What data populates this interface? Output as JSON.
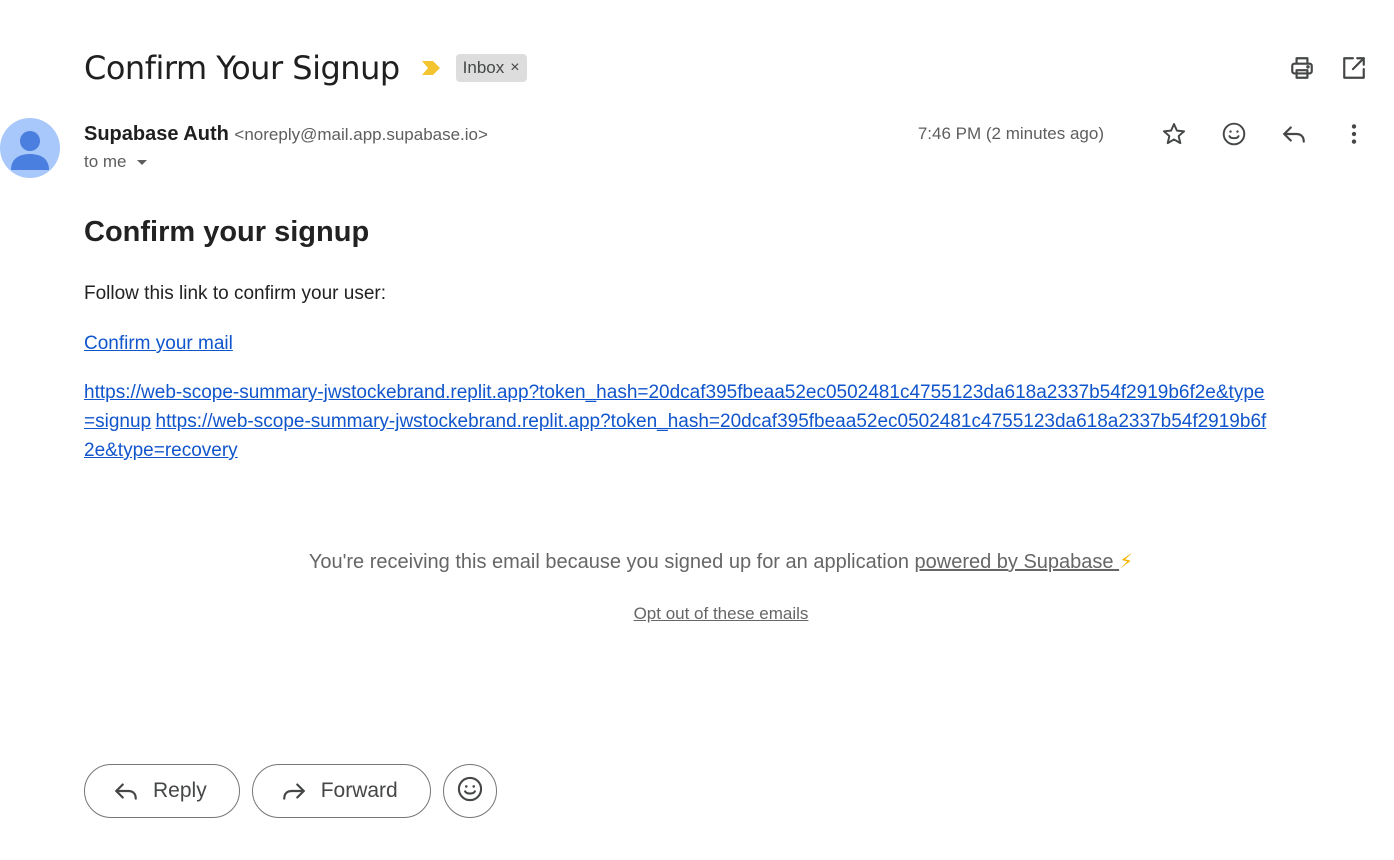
{
  "subject": {
    "title": "Confirm Your Signup",
    "label": "Inbox",
    "label_remove": "×"
  },
  "top_actions": [
    "print-icon",
    "open-in-new-window-icon"
  ],
  "sender": {
    "name": "Supabase Auth",
    "email": "<noreply@mail.app.supabase.io>",
    "to_text": "to me",
    "timestamp": "7:46 PM (2 minutes ago)"
  },
  "message_actions": [
    "star-icon",
    "emoji-reaction-icon",
    "reply-icon",
    "more-vert-icon"
  ],
  "body": {
    "heading": "Confirm your signup",
    "intro": "Follow this link to confirm your user:",
    "confirm_link": "Confirm your mail",
    "signup_url": "https://web-scope-summary-jwstockebrand.replit.app?token_hash=20dcaf395fbeaa52ec0502481c4755123da618a2337b54f2919b6f2e&type=signup",
    "recovery_url": "https://web-scope-summary-jwstockebrand.replit.app?token_hash=20dcaf395fbeaa52ec0502481c4755123da618a2337b54f2919b6f2e&type=recovery"
  },
  "footer": {
    "notice": "You're receiving this email because you signed up for an application ",
    "powered_by": "powered by Supabase ",
    "bolt": "⚡",
    "opt_out": "Opt out of these emails"
  },
  "bottom_actions": {
    "reply": "Reply",
    "forward": "Forward"
  },
  "colors": {
    "link": "#1155cc",
    "avatar_bg": "#a8c7fa",
    "avatar_fg": "#4a7fe0",
    "importance": "#f4c430",
    "chip_bg": "#dddddd"
  }
}
